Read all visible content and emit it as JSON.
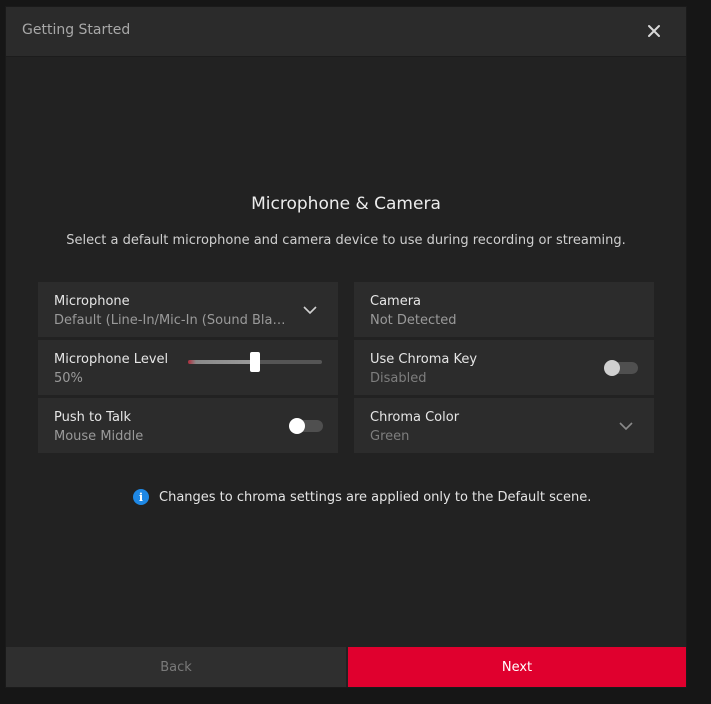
{
  "window": {
    "title": "Getting Started",
    "close_icon": "close-icon"
  },
  "content": {
    "heading": "Microphone & Camera",
    "subheading": "Select a default microphone and camera device to use during recording or streaming."
  },
  "settings": {
    "microphone": {
      "label": "Microphone",
      "value": "Default (Line-In/Mic-In (Sound Bla…",
      "icon": "chevron-down-icon"
    },
    "camera": {
      "label": "Camera",
      "value": "Not Detected"
    },
    "microphone_level": {
      "label": "Microphone Level",
      "value": "50%",
      "level": 0.5
    },
    "chroma_key": {
      "label": "Use Chroma Key",
      "value": "Disabled",
      "on": false
    },
    "push_to_talk": {
      "label": "Push to Talk",
      "value": "Mouse Middle",
      "on": false
    },
    "chroma_color": {
      "label": "Chroma Color",
      "value": "Green",
      "icon": "chevron-down-icon"
    }
  },
  "info": {
    "icon": "info-icon",
    "text": "Changes to chroma settings are applied only to the Default scene."
  },
  "footer": {
    "back_label": "Back",
    "next_label": "Next"
  },
  "colors": {
    "accent": "#e0002e",
    "info": "#1e88e5"
  }
}
